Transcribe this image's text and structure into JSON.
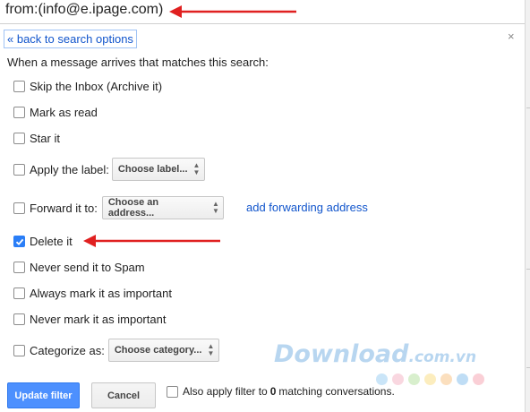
{
  "search": {
    "query": "from:(info@e.ipage.com)"
  },
  "panel": {
    "back_link": "« back to search options",
    "close": "×",
    "intro": "When a message arrives that matches this search:"
  },
  "options": [
    {
      "label": "Skip the Inbox (Archive it)",
      "checked": false
    },
    {
      "label": "Mark as read",
      "checked": false
    },
    {
      "label": "Star it",
      "checked": false
    },
    {
      "label": "Apply the label:",
      "checked": false,
      "select": "Choose label..."
    },
    {
      "label": "Forward it to:",
      "checked": false,
      "select": "Choose an address...",
      "link": "add forwarding address"
    },
    {
      "label": "Delete it",
      "checked": true
    },
    {
      "label": "Never send it to Spam",
      "checked": false
    },
    {
      "label": "Always mark it as important",
      "checked": false
    },
    {
      "label": "Never mark it as important",
      "checked": false
    },
    {
      "label": "Categorize as:",
      "checked": false,
      "select": "Choose category..."
    }
  ],
  "footer": {
    "update_button": "Update filter",
    "cancel_button": "Cancel",
    "also_apply_prefix": "Also apply filter to",
    "also_apply_count": "0",
    "also_apply_suffix": "matching conversations.",
    "also_apply_checked": false
  },
  "watermark": {
    "brand": "Download",
    "domain": ".com.vn"
  },
  "colors": {
    "link": "#1155cc",
    "primary_button": "#4d90fe",
    "checked_box": "#2a7ef7",
    "annotation_arrow": "#e02020",
    "watermark_dots": [
      "#9fd0f3",
      "#f5b8c8",
      "#b9e3a6",
      "#fbe08a",
      "#f9c68a",
      "#8cc3ee",
      "#f6a9b5"
    ]
  }
}
